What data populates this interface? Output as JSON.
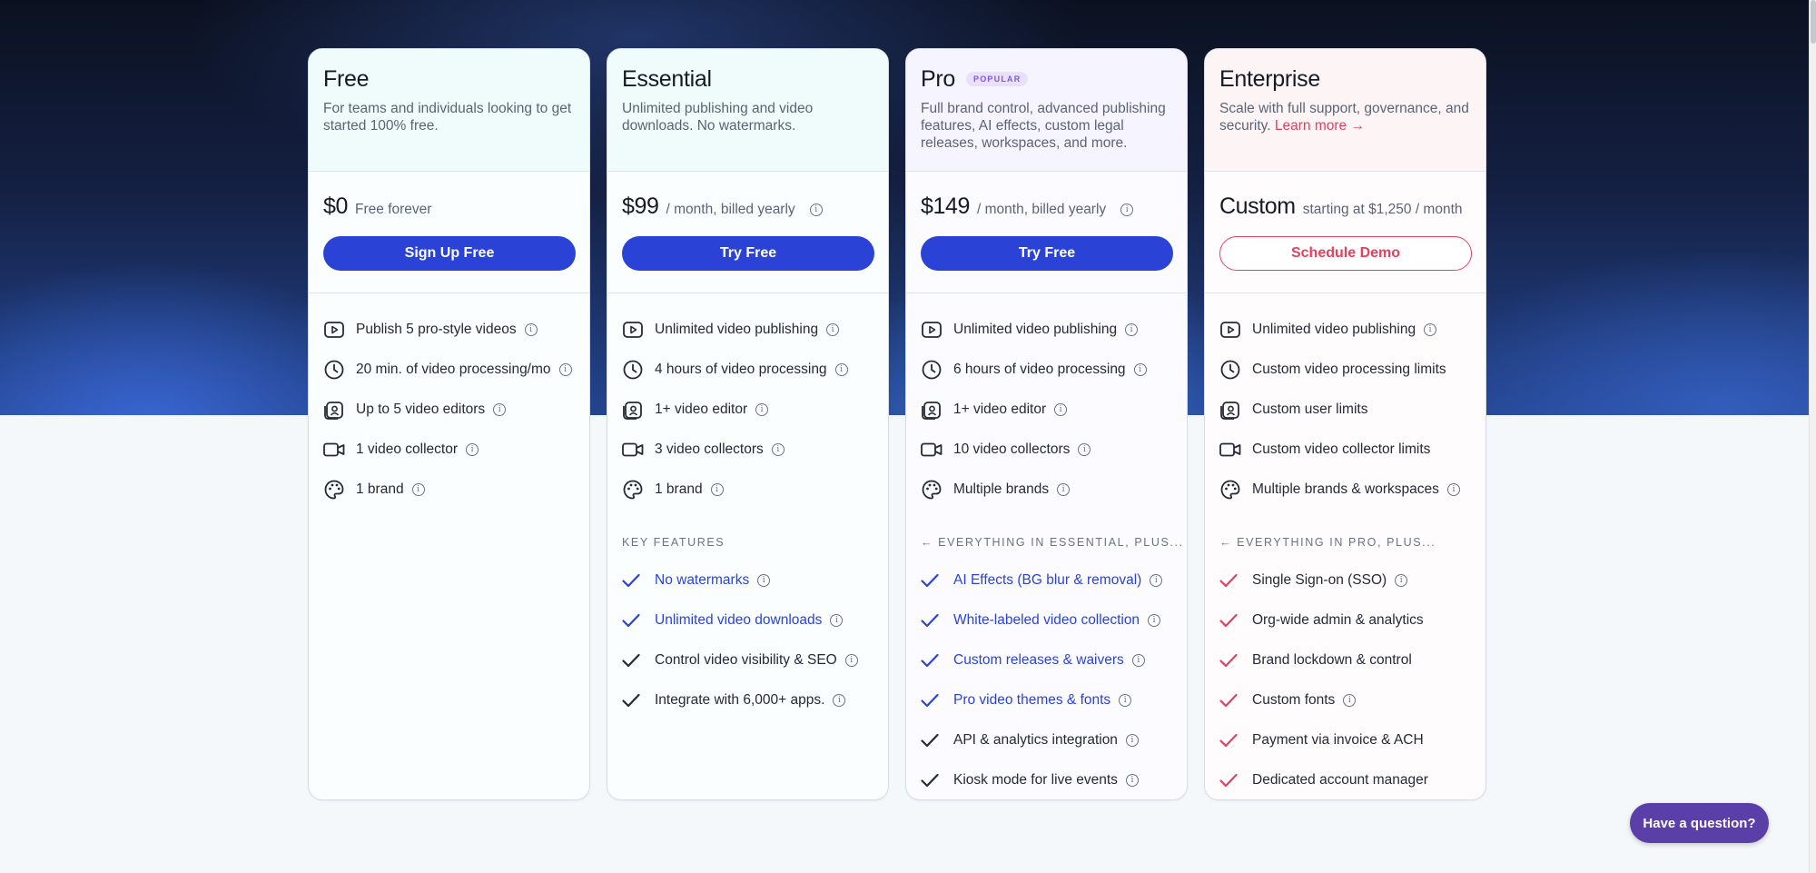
{
  "plans": [
    {
      "name": "Free",
      "description": "For teams and individuals looking to get started 100% free.",
      "price": "$0",
      "price_note": "Free forever",
      "cta": "Sign Up Free",
      "features": [
        "Publish 5 pro-style videos",
        "20 min. of video processing/mo",
        "Up to 5 video editors",
        "1 video collector",
        "1 brand"
      ]
    },
    {
      "name": "Essential",
      "description": "Unlimited publishing and video downloads. No watermarks.",
      "price": "$99",
      "price_note": "/ month, billed yearly",
      "cta": "Try Free",
      "features": [
        "Unlimited video publishing",
        "4 hours of video processing",
        "1+ video editor",
        "3 video collectors",
        "1 brand"
      ],
      "section_label": "KEY FEATURES",
      "key_features": [
        "No watermarks",
        "Unlimited video downloads",
        "Control video visibility & SEO",
        "Integrate with 6,000+ apps."
      ]
    },
    {
      "name": "Pro",
      "badge": "POPULAR",
      "description": "Full brand control, advanced publishing features, AI effects, custom legal releases, workspaces, and more.",
      "price": "$149",
      "price_note": "/ month, billed yearly",
      "cta": "Try Free",
      "features": [
        "Unlimited video publishing",
        "6 hours of video processing",
        "1+ video editor",
        "10 video collectors",
        "Multiple brands"
      ],
      "section_label": "← EVERYTHING IN ESSENTIAL, PLUS...",
      "key_features": [
        "AI Effects (BG blur & removal)",
        "White-labeled video collection",
        "Custom releases & waivers",
        "Pro video themes & fonts",
        "API & analytics integration",
        "Kiosk mode for live events"
      ]
    },
    {
      "name": "Enterprise",
      "description": "Scale with full support, governance, and security.",
      "learn_more": "Learn more →",
      "price": "Custom",
      "price_note": "starting at $1,250 / month",
      "cta": "Schedule Demo",
      "features": [
        "Unlimited video publishing",
        "Custom video processing limits",
        "Custom user limits",
        "Custom video collector limits",
        "Multiple brands & workspaces"
      ],
      "section_label": "← EVERYTHING IN PRO, PLUS...",
      "key_features": [
        "Single Sign-on (SSO)",
        "Org-wide admin & analytics",
        "Brand lockdown & control",
        "Custom fonts",
        "Payment via invoice & ACH",
        "Dedicated account manager"
      ]
    }
  ],
  "chat_button": "Have a question?",
  "info_glyph": "i",
  "colors": {
    "primary_blue": "#2a43d6",
    "enterprise_pink": "#e5405e",
    "popular_purple": "#7e5bd6",
    "chat_purple": "#5b3fa8"
  },
  "feature_icons": [
    "play-video-icon",
    "clock-icon",
    "user-badge-icon",
    "video-camera-icon",
    "palette-icon"
  ]
}
